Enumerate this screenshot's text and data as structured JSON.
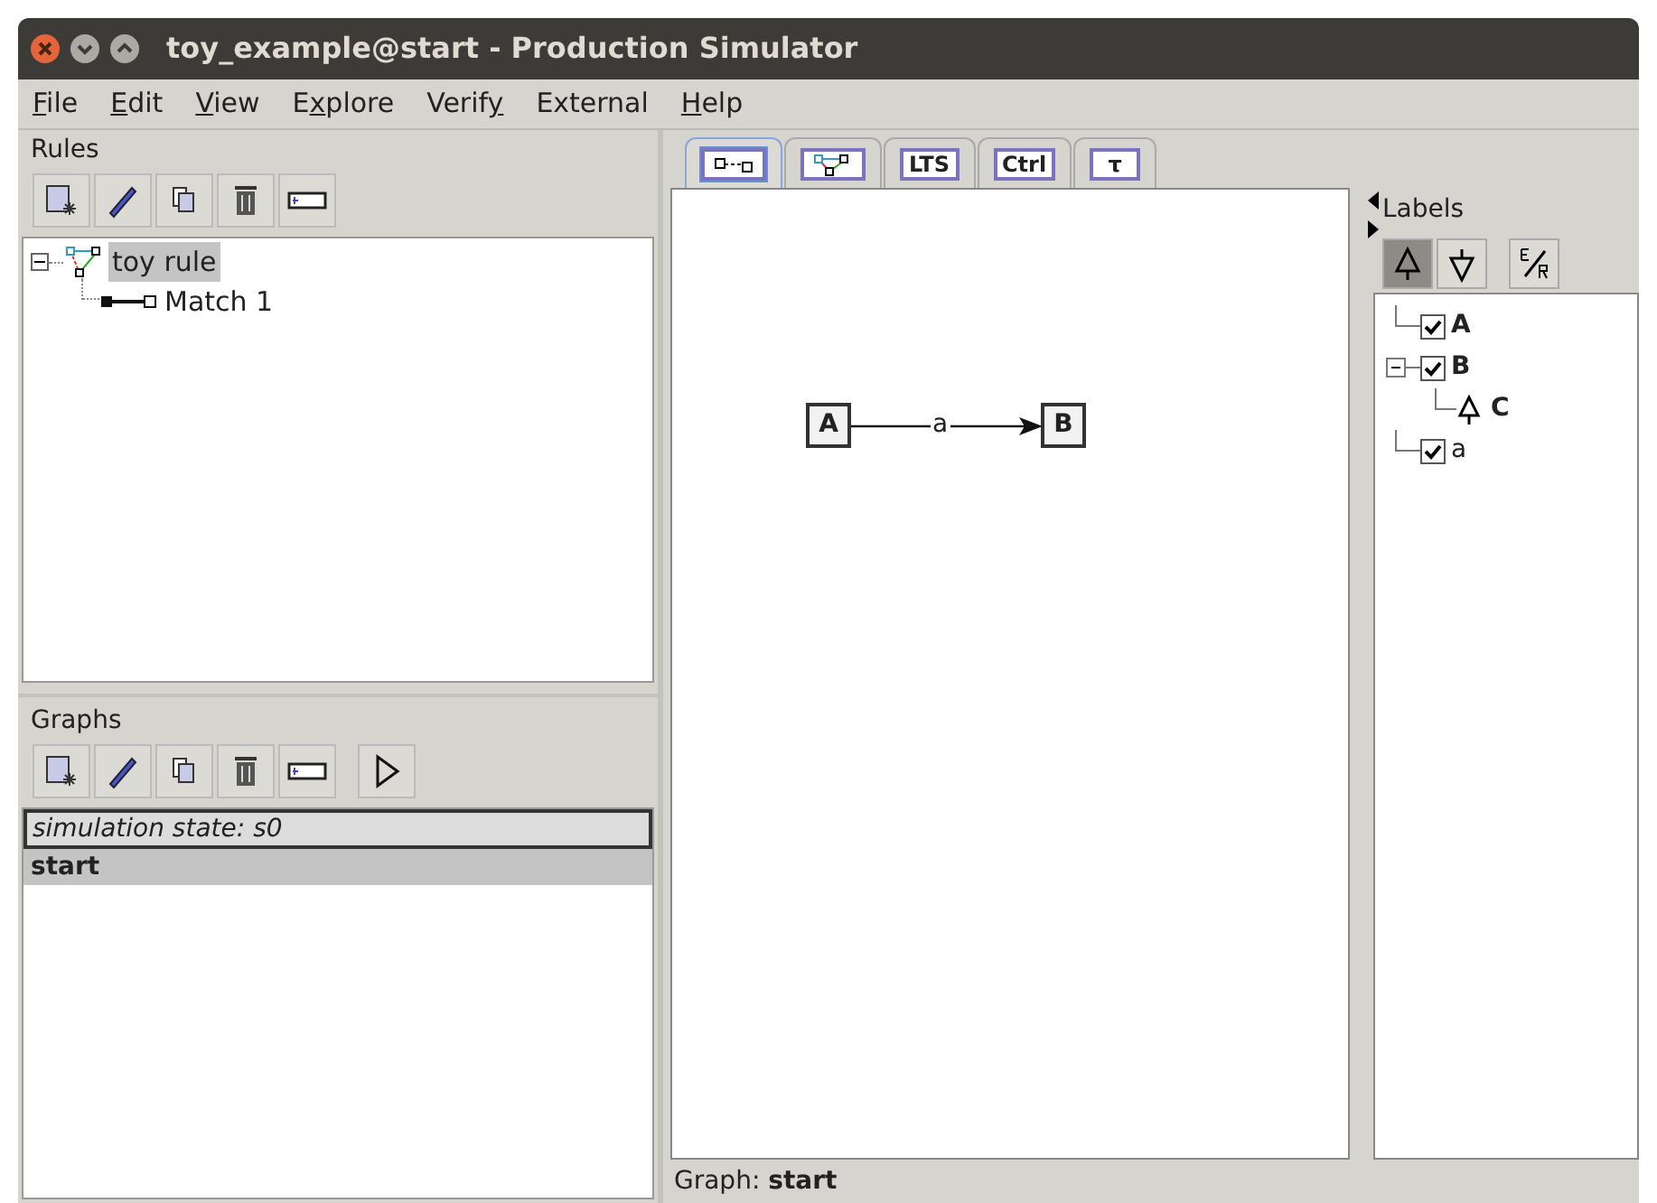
{
  "window": {
    "title": "toy_example@start - Production Simulator"
  },
  "menu": [
    {
      "mnemonic": "F",
      "after": "ile"
    },
    {
      "mnemonic": "E",
      "after": "dit"
    },
    {
      "mnemonic": "V",
      "after": "iew"
    },
    {
      "before": "E",
      "mnemonic": "x",
      "after": "plore"
    },
    {
      "before": "Verif",
      "mnemonic": "y"
    },
    {
      "before": "External"
    },
    {
      "mnemonic": "H",
      "after": "elp"
    }
  ],
  "rules": {
    "title": "Rules",
    "tools": [
      {
        "kind": "new"
      },
      {
        "kind": "edit"
      },
      {
        "kind": "copy"
      },
      {
        "kind": "delete"
      },
      {
        "kind": "rename"
      }
    ],
    "tree": [
      {
        "label": "toy rule",
        "kind": "rule",
        "selected": true,
        "expanded": true,
        "children": [
          {
            "label": "Match 1",
            "kind": "match",
            "selected": false
          }
        ]
      }
    ]
  },
  "graphs": {
    "title": "Graphs",
    "tools": [
      {
        "kind": "new"
      },
      {
        "kind": "edit"
      },
      {
        "kind": "copy"
      },
      {
        "kind": "delete"
      },
      {
        "kind": "rename"
      },
      {
        "kind": "play"
      }
    ],
    "state_label": "simulation state: s0",
    "items": [
      {
        "label": "start",
        "selected": true
      }
    ]
  },
  "tabs": [
    {
      "kind": "graph",
      "selected": true
    },
    {
      "kind": "rule",
      "selected": false
    },
    {
      "kind": "text",
      "label": "LTS",
      "selected": false
    },
    {
      "kind": "text",
      "label": "Ctrl",
      "selected": false
    },
    {
      "kind": "text",
      "label": "τ",
      "selected": false
    }
  ],
  "canvas": {
    "nodes": [
      {
        "label": "A"
      },
      {
        "label": "B"
      }
    ],
    "edges": [
      {
        "label": "a"
      }
    ]
  },
  "labels": {
    "title": "Labels",
    "tools": [
      {
        "kind": "supertype",
        "selected": true
      },
      {
        "kind": "subtype",
        "selected": false
      },
      {
        "kind": "filter",
        "selected": false
      }
    ],
    "tree": [
      {
        "label": "A",
        "kind": "node",
        "checked": true
      },
      {
        "label": "B",
        "kind": "node",
        "checked": true,
        "expanded": true,
        "children": [
          {
            "label": "C",
            "kind": "subtype"
          }
        ]
      },
      {
        "label": "a",
        "kind": "edge",
        "checked": true
      }
    ]
  },
  "status": {
    "label": "Graph:",
    "value": "start"
  }
}
